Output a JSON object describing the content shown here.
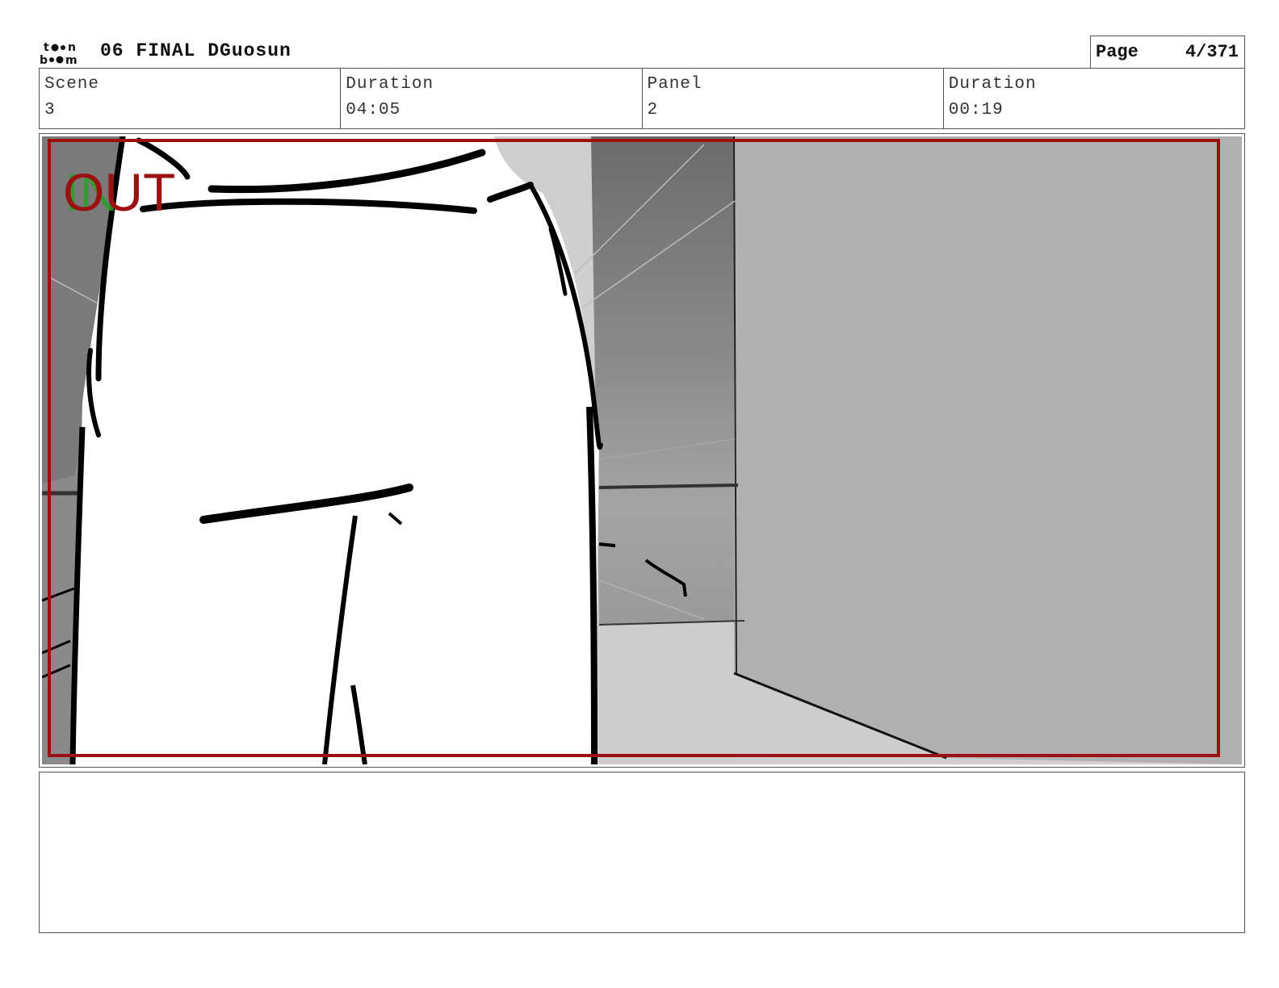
{
  "header": {
    "title": "06 FINAL DGuosun",
    "logo_icon": "toonboom-logo-icon",
    "page_label": "Page",
    "page_value": "4/371"
  },
  "info": {
    "scene_label": "Scene",
    "scene_value": "3",
    "scene_duration_label": "Duration",
    "scene_duration_value": "04:05",
    "panel_label": "Panel",
    "panel_value": "2",
    "panel_duration_label": "Duration",
    "panel_duration_value": "00:19"
  },
  "panel": {
    "overlay_text": "OUT",
    "safe_frame_color": "#9b1010",
    "overlay_in_color": "#2aa02a"
  },
  "notes": {
    "text": ""
  }
}
